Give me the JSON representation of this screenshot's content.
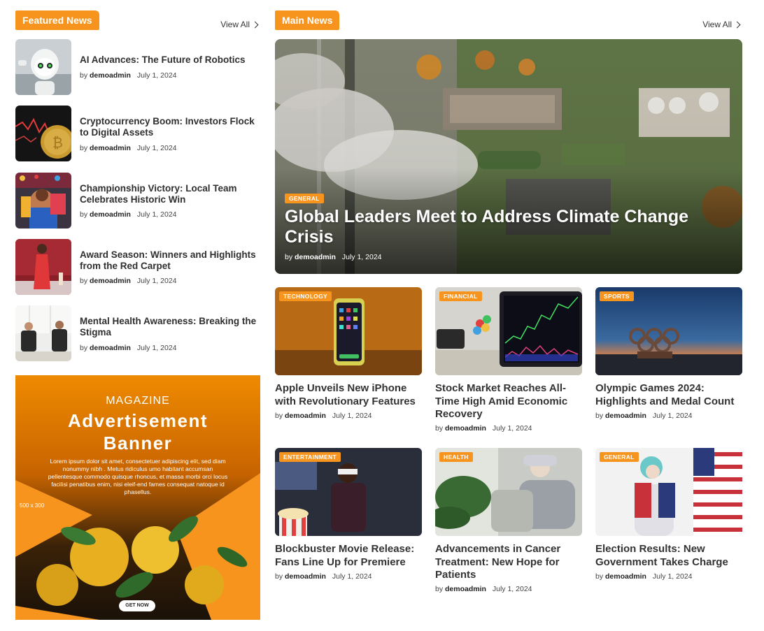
{
  "featured": {
    "heading": "Featured News",
    "view_all": "View All",
    "items": [
      {
        "title": "AI Advances: The Future of Robotics",
        "by": "by",
        "author": "demoadmin",
        "date": "July 1, 2024"
      },
      {
        "title": "Cryptocurrency Boom: Investors Flock to Digital Assets",
        "by": "by",
        "author": "demoadmin",
        "date": "July 1, 2024"
      },
      {
        "title": "Championship Victory: Local Team Celebrates Historic Win",
        "by": "by",
        "author": "demoadmin",
        "date": "July 1, 2024"
      },
      {
        "title": "Award Season: Winners and Highlights from the Red Carpet",
        "by": "by",
        "author": "demoadmin",
        "date": "July 1, 2024"
      },
      {
        "title": "Mental Health Awareness: Breaking the Stigma",
        "by": "by",
        "author": "demoadmin",
        "date": "July 1, 2024"
      }
    ]
  },
  "ad": {
    "kicker": "MAGAZINE",
    "line1": "Advertisement",
    "line2": "Banner",
    "body": "Lorem ipsum dolor sit amet, consectetuer adipiscing elit, sed diam nonummy nibh . Metus ridiculus umo habitant accumsan pellentesque commodo quisque rhoncus, et massa morbi orci locus facilisi penatibus enim, nisi eleif-end fames consequat natoque id phasellus.",
    "size": "500 x 300",
    "button": "GET NOW"
  },
  "main": {
    "heading": "Main News",
    "view_all": "View All",
    "hero": {
      "category": "GENERAL",
      "title": "Global Leaders Meet to Address Climate Change Crisis",
      "by": "by",
      "author": "demoadmin",
      "date": "July 1, 2024"
    },
    "cards": [
      {
        "category": "TECHNOLOGY",
        "title": "Apple Unveils New iPhone with Revolutionary Features",
        "by": "by",
        "author": "demoadmin",
        "date": "July 1, 2024"
      },
      {
        "category": "FINANCIAL",
        "title": "Stock Market Reaches All-Time High Amid Economic Recovery",
        "by": "by",
        "author": "demoadmin",
        "date": "July 1, 2024"
      },
      {
        "category": "SPORTS",
        "title": "Olympic Games 2024: Highlights and Medal Count",
        "by": "by",
        "author": "demoadmin",
        "date": "July 1, 2024"
      },
      {
        "category": "ENTERTAINMENT",
        "title": "Blockbuster Movie Release: Fans Line Up for Premiere",
        "by": "by",
        "author": "demoadmin",
        "date": "July 1, 2024"
      },
      {
        "category": "HEALTH",
        "title": "Advancements in Cancer Treatment: New Hope for Patients",
        "by": "by",
        "author": "demoadmin",
        "date": "July 1, 2024"
      },
      {
        "category": "GENERAL",
        "title": "Election Results: New Government Takes Charge",
        "by": "by",
        "author": "demoadmin",
        "date": "July 1, 2024"
      }
    ]
  },
  "colors": {
    "accent": "#f7941d"
  }
}
